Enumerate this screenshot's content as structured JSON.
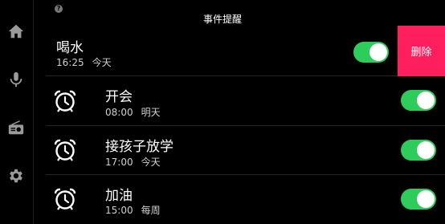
{
  "header": {
    "title": "事件提醒"
  },
  "sidebar": {
    "items": [
      {
        "icon": "home-icon"
      },
      {
        "icon": "microphone-icon"
      },
      {
        "icon": "radio-icon"
      },
      {
        "icon": "gear-icon"
      }
    ]
  },
  "help": {
    "glyph": "?"
  },
  "reminders": [
    {
      "title": "喝水",
      "time": "16:25",
      "day": "今天",
      "enabled": true,
      "swiped": true,
      "icon": ""
    },
    {
      "title": "开会",
      "time": "08:00",
      "day": "明天",
      "enabled": true,
      "swiped": false,
      "icon": "alarm-clock-icon"
    },
    {
      "title": "接孩子放学",
      "time": "17:00",
      "day": "今天",
      "enabled": true,
      "swiped": false,
      "icon": "alarm-clock-icon"
    },
    {
      "title": "加油",
      "time": "15:00",
      "day": "每周",
      "enabled": true,
      "swiped": false,
      "icon": "alarm-clock-icon"
    }
  ],
  "delete_label": "删除",
  "colors": {
    "toggle_on": "#2ecc5a",
    "delete": "#ff1f5f",
    "background": "#000000"
  }
}
